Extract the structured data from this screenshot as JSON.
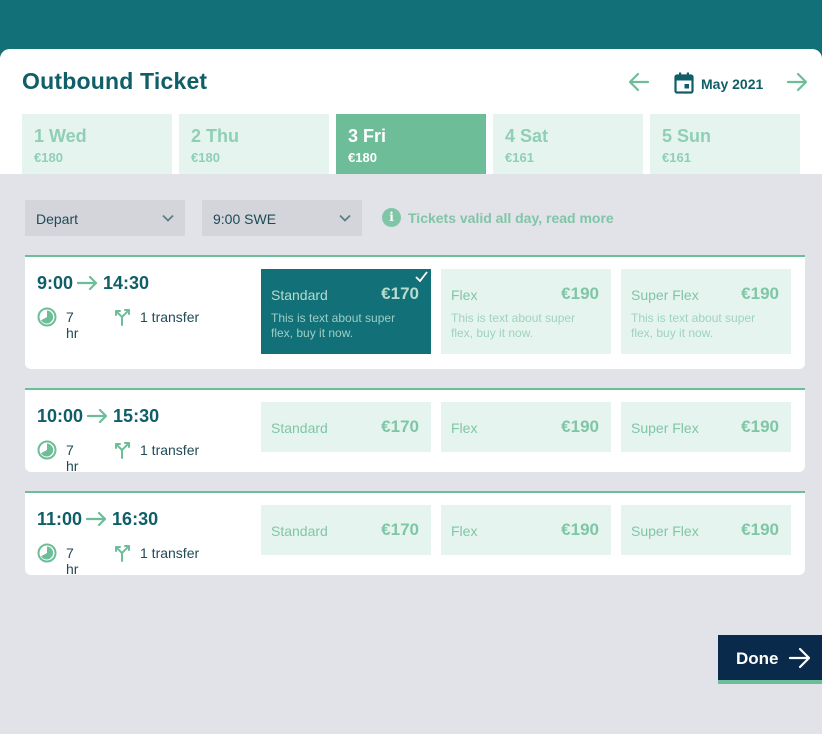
{
  "header": {
    "title": "Outbound Ticket",
    "month": "May 2021",
    "prev_icon": "arrow-left-icon",
    "next_icon": "arrow-right-icon",
    "calendar_icon": "calendar-icon"
  },
  "days": [
    {
      "label": "1 Wed",
      "price": "€180",
      "selected": false
    },
    {
      "label": "2 Thu",
      "price": "€180",
      "selected": false
    },
    {
      "label": "3 Fri",
      "price": "€180",
      "selected": true
    },
    {
      "label": "4 Sat",
      "price": "€161",
      "selected": false
    },
    {
      "label": "5 Sun",
      "price": "€161",
      "selected": false
    }
  ],
  "filters": {
    "direction": "Depart",
    "time": "9:00 SWE",
    "info_text": "Tickets valid all day, read more",
    "info_icon_glyph": "i"
  },
  "journeys": [
    {
      "depart": "9:00",
      "arrive": "14:30",
      "duration": "7 hr",
      "transfers": "1 transfer",
      "options": [
        {
          "name": "Standard",
          "price": "€170",
          "desc": "This is text about super flex, buy it now.",
          "selected": true
        },
        {
          "name": "Flex",
          "price": "€190",
          "desc": "This is text about super flex, buy it now.",
          "selected": false
        },
        {
          "name": "Super Flex",
          "price": "€190",
          "desc": "This is text about super flex, buy it now.",
          "selected": false
        }
      ]
    },
    {
      "depart": "10:00",
      "arrive": "15:30",
      "duration": "7 hr",
      "transfers": "1 transfer",
      "options": [
        {
          "name": "Standard",
          "price": "€170",
          "selected": false
        },
        {
          "name": "Flex",
          "price": "€190",
          "selected": false
        },
        {
          "name": "Super Flex",
          "price": "€190",
          "selected": false
        }
      ]
    },
    {
      "depart": "11:00",
      "arrive": "16:30",
      "duration": "7 hr",
      "transfers": "1 transfer",
      "options": [
        {
          "name": "Standard",
          "price": "€170",
          "selected": false
        },
        {
          "name": "Flex",
          "price": "€190",
          "selected": false
        },
        {
          "name": "Super Flex",
          "price": "€190",
          "selected": false
        }
      ]
    }
  ],
  "footer": {
    "done_label": "Done"
  },
  "colors": {
    "brand_dark": "#117078",
    "accent": "#6dbd98",
    "navy": "#0a2a4b"
  }
}
